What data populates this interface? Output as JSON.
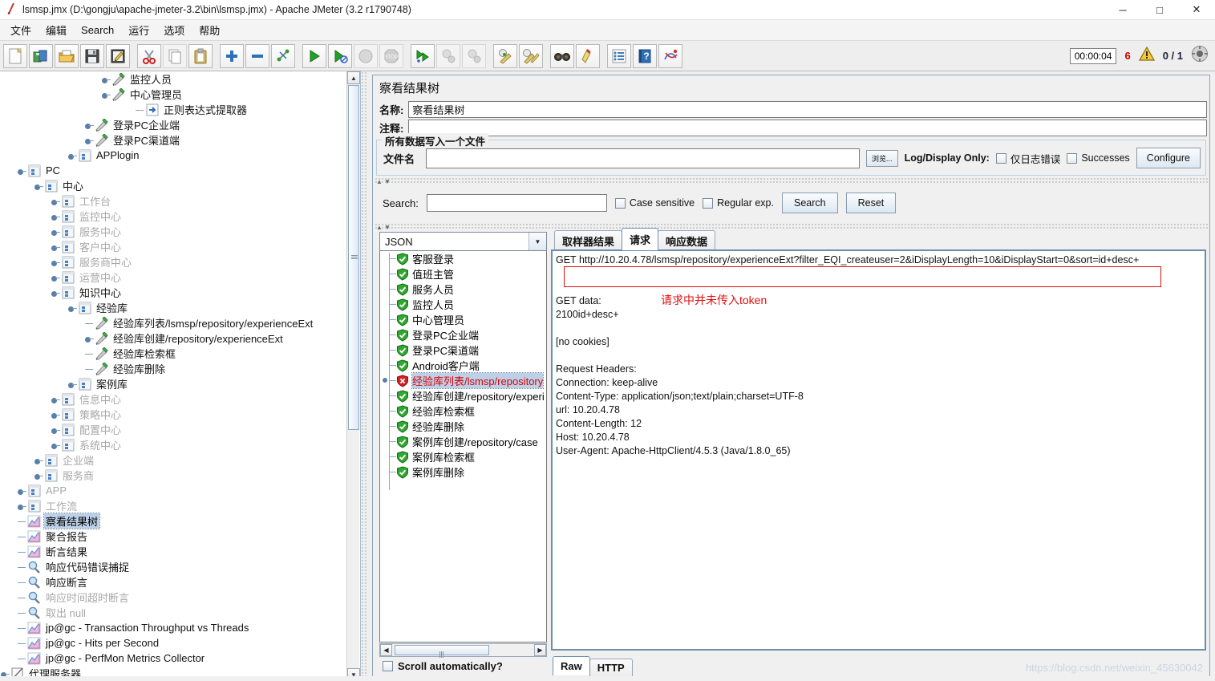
{
  "window": {
    "title": "lsmsp.jmx (D:\\gongju\\apache-jmeter-3.2\\bin\\lsmsp.jmx) - Apache JMeter (3.2 r1790748)",
    "minimize": "─",
    "maximize": "□",
    "close": "✕"
  },
  "menu": [
    "文件",
    "编辑",
    "Search",
    "运行",
    "选项",
    "帮助"
  ],
  "toolbar": {
    "buttons": [
      {
        "name": "new-icon"
      },
      {
        "name": "templates-icon"
      },
      {
        "name": "open-icon"
      },
      {
        "name": "save-icon"
      },
      {
        "name": "save-as-icon"
      },
      {
        "name": "cut-icon"
      },
      {
        "name": "copy-icon"
      },
      {
        "name": "paste-icon"
      },
      {
        "name": "expand-icon"
      },
      {
        "name": "collapse-icon"
      },
      {
        "name": "toggle-icon"
      },
      {
        "name": "start-icon"
      },
      {
        "name": "start-no-pause-icon"
      },
      {
        "name": "stop-icon"
      },
      {
        "name": "shutdown-icon"
      },
      {
        "name": "start-remote-icon"
      },
      {
        "name": "stop-remote-icon"
      },
      {
        "name": "shutdown-remote-icon"
      },
      {
        "name": "clear-icon"
      },
      {
        "name": "clear-all-icon"
      },
      {
        "name": "search-icon"
      },
      {
        "name": "search-reset-icon"
      },
      {
        "name": "function-helper-icon"
      },
      {
        "name": "help-icon"
      },
      {
        "name": "undo-redo-icon"
      }
    ],
    "timer": "00:00:04",
    "warnings": "6",
    "threads": "0 / 1"
  },
  "tree": {
    "items": [
      {
        "label": "监控人员",
        "indent": 6,
        "icon": "sampler",
        "disabled": false,
        "expandable": true
      },
      {
        "label": "中心管理员",
        "indent": 6,
        "icon": "sampler",
        "disabled": false,
        "expandable": true
      },
      {
        "label": "正则表达式提取器",
        "indent": 8,
        "icon": "extractor",
        "disabled": false,
        "expandable": false
      },
      {
        "label": "登录PC企业端",
        "indent": 5,
        "icon": "sampler",
        "disabled": false,
        "expandable": true
      },
      {
        "label": "登录PC渠道端",
        "indent": 5,
        "icon": "sampler",
        "disabled": false,
        "expandable": true
      },
      {
        "label": "APPlogin",
        "indent": 4,
        "icon": "controller",
        "disabled": false,
        "expandable": true
      },
      {
        "label": "PC",
        "indent": 1,
        "icon": "controller",
        "disabled": false,
        "expandable": true
      },
      {
        "label": "中心",
        "indent": 2,
        "icon": "controller",
        "disabled": false,
        "expandable": true
      },
      {
        "label": "工作台",
        "indent": 3,
        "icon": "controller",
        "disabled": true,
        "expandable": true
      },
      {
        "label": "监控中心",
        "indent": 3,
        "icon": "controller",
        "disabled": true,
        "expandable": true
      },
      {
        "label": "服务中心",
        "indent": 3,
        "icon": "controller",
        "disabled": true,
        "expandable": true
      },
      {
        "label": "客户中心",
        "indent": 3,
        "icon": "controller",
        "disabled": true,
        "expandable": true
      },
      {
        "label": "服务商中心",
        "indent": 3,
        "icon": "controller",
        "disabled": true,
        "expandable": true
      },
      {
        "label": "运营中心",
        "indent": 3,
        "icon": "controller",
        "disabled": true,
        "expandable": true
      },
      {
        "label": "知识中心",
        "indent": 3,
        "icon": "controller",
        "disabled": false,
        "expandable": true
      },
      {
        "label": "经验库",
        "indent": 4,
        "icon": "controller",
        "disabled": false,
        "expandable": true
      },
      {
        "label": "经验库列表/lsmsp/repository/experienceExt",
        "indent": 5,
        "icon": "sampler",
        "disabled": false,
        "expandable": false
      },
      {
        "label": "经验库创建/repository/experienceExt",
        "indent": 5,
        "icon": "sampler",
        "disabled": false,
        "expandable": true
      },
      {
        "label": "经验库检索框",
        "indent": 5,
        "icon": "sampler",
        "disabled": false,
        "expandable": false
      },
      {
        "label": "经验库删除",
        "indent": 5,
        "icon": "sampler",
        "disabled": false,
        "expandable": false
      },
      {
        "label": "案例库",
        "indent": 4,
        "icon": "controller",
        "disabled": false,
        "expandable": true
      },
      {
        "label": "信息中心",
        "indent": 3,
        "icon": "controller",
        "disabled": true,
        "expandable": true
      },
      {
        "label": "策略中心",
        "indent": 3,
        "icon": "controller",
        "disabled": true,
        "expandable": true
      },
      {
        "label": "配置中心",
        "indent": 3,
        "icon": "controller",
        "disabled": true,
        "expandable": true
      },
      {
        "label": "系统中心",
        "indent": 3,
        "icon": "controller",
        "disabled": true,
        "expandable": true
      },
      {
        "label": "企业端",
        "indent": 2,
        "icon": "controller",
        "disabled": true,
        "expandable": true
      },
      {
        "label": "服务商",
        "indent": 2,
        "icon": "controller",
        "disabled": true,
        "expandable": true
      },
      {
        "label": "APP",
        "indent": 1,
        "icon": "controller",
        "disabled": true,
        "expandable": true
      },
      {
        "label": "工作流",
        "indent": 1,
        "icon": "controller",
        "disabled": true,
        "expandable": true
      },
      {
        "label": "察看结果树",
        "indent": 1,
        "icon": "listener",
        "disabled": false,
        "expandable": false,
        "selected": true
      },
      {
        "label": "聚合报告",
        "indent": 1,
        "icon": "listener",
        "disabled": false,
        "expandable": false
      },
      {
        "label": "断言结果",
        "indent": 1,
        "icon": "listener",
        "disabled": false,
        "expandable": false
      },
      {
        "label": "响应代码错误捕捉",
        "indent": 1,
        "icon": "assertion",
        "disabled": false,
        "expandable": false
      },
      {
        "label": "响应断言",
        "indent": 1,
        "icon": "assertion",
        "disabled": false,
        "expandable": false
      },
      {
        "label": "响应时间超时断言",
        "indent": 1,
        "icon": "assertion",
        "disabled": true,
        "expandable": false
      },
      {
        "label": "取出 null",
        "indent": 1,
        "icon": "assertion",
        "disabled": true,
        "expandable": false
      },
      {
        "label": "jp@gc - Transaction Throughput vs Threads",
        "indent": 1,
        "icon": "listener",
        "disabled": false,
        "expandable": false
      },
      {
        "label": "jp@gc - Hits per Second",
        "indent": 1,
        "icon": "listener",
        "disabled": false,
        "expandable": false
      },
      {
        "label": "jp@gc - PerfMon Metrics Collector",
        "indent": 1,
        "icon": "listener",
        "disabled": false,
        "expandable": false
      },
      {
        "label": "代理服务器",
        "indent": 0,
        "icon": "workbench",
        "disabled": false,
        "expandable": true
      }
    ]
  },
  "panel": {
    "title": "察看结果树",
    "name_label": "名称:",
    "name_value": "察看结果树",
    "comment_label": "注释:",
    "comment_value": "",
    "file_group_title": "所有数据写入一个文件",
    "filename_label": "文件名",
    "filename_value": "",
    "browse_label": "浏览...",
    "log_display_label": "Log/Display Only:",
    "errors_only_label": "仅日志错误",
    "successes_label": "Successes",
    "configure_label": "Configure"
  },
  "search": {
    "label": "Search:",
    "value": "",
    "case_sensitive_label": "Case sensitive",
    "regex_label": "Regular exp.",
    "search_button": "Search",
    "reset_button": "Reset"
  },
  "results": {
    "renderer": "JSON",
    "items": [
      {
        "label": "客服登录",
        "status": "ok"
      },
      {
        "label": "值班主管",
        "status": "ok"
      },
      {
        "label": "服务人员",
        "status": "ok"
      },
      {
        "label": "监控人员",
        "status": "ok"
      },
      {
        "label": "中心管理员",
        "status": "ok"
      },
      {
        "label": "登录PC企业端",
        "status": "ok"
      },
      {
        "label": "登录PC渠道端",
        "status": "ok"
      },
      {
        "label": "Android客户端",
        "status": "ok"
      },
      {
        "label": "经验库列表/lsmsp/repository",
        "status": "error",
        "selected": true
      },
      {
        "label": "经验库创建/repository/experi",
        "status": "ok"
      },
      {
        "label": "经验库检索框",
        "status": "ok"
      },
      {
        "label": "经验库删除",
        "status": "ok"
      },
      {
        "label": "案例库创建/repository/case",
        "status": "ok"
      },
      {
        "label": "案例库检索框",
        "status": "ok"
      },
      {
        "label": "案例库删除",
        "status": "ok"
      }
    ],
    "scroll_auto_label": "Scroll automatically?"
  },
  "detail": {
    "tabs": [
      {
        "label": "取样器结果",
        "active": false
      },
      {
        "label": "请求",
        "active": true
      },
      {
        "label": "响应数据",
        "active": false
      }
    ],
    "request_text": "GET http://10.20.4.78/lsmsp/repository/experienceExt?filter_EQI_createuser=2&iDisplayLength=10&iDisplayStart=0&sort=id+desc+\n\n\nGET data:\n2100id+desc+\n\n[no cookies]\n\nRequest Headers:\nConnection: keep-alive\nContent-Type: application/json;text/plain;charset=UTF-8\nurl: 10.20.4.78\nContent-Length: 12\nHost: 10.20.4.78\nUser-Agent: Apache-HttpClient/4.5.3 (Java/1.8.0_65)",
    "annotation": "请求中并未传入token",
    "annotation_color": "#e01010",
    "bottom_tabs": [
      {
        "label": "Raw",
        "active": true
      },
      {
        "label": "HTTP",
        "active": false
      }
    ]
  },
  "watermark": "https://blog.csdn.net/weixin_45630042"
}
